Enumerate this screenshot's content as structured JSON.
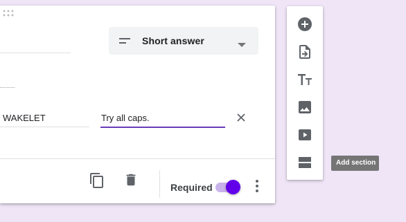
{
  "question": {
    "type_select": {
      "label": "Short answer",
      "icon": "short-answer-icon"
    },
    "option_label": "WAKELET",
    "option_value": "Try all caps."
  },
  "footer": {
    "required_label": "Required",
    "required_on": true
  },
  "toolbar": {
    "items": [
      {
        "icon": "add-circle-icon",
        "name": "Add question"
      },
      {
        "icon": "import-icon",
        "name": "Import questions"
      },
      {
        "icon": "title-icon",
        "name": "Add title and description"
      },
      {
        "icon": "image-icon",
        "name": "Add image"
      },
      {
        "icon": "video-icon",
        "name": "Add video"
      },
      {
        "icon": "section-icon",
        "name": "Add section"
      }
    ],
    "tooltip": "Add section"
  },
  "colors": {
    "background": "#efe5f7",
    "accent": "#673ab7",
    "toggle_thumb": "#6200ea",
    "tooltip_bg": "#757575"
  }
}
